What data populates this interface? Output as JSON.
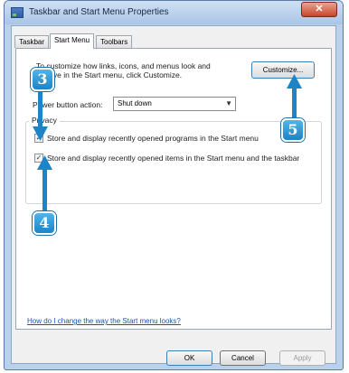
{
  "window": {
    "title": "Taskbar and Start Menu Properties",
    "close_glyph": "✕"
  },
  "tabs": [
    {
      "label": "Taskbar",
      "active": false
    },
    {
      "label": "Start Menu",
      "active": true
    },
    {
      "label": "Toolbars",
      "active": false
    }
  ],
  "start_menu": {
    "description": "To customize how links, icons, and menus look and behave in the Start menu, click Customize.",
    "customize_label": "Customize...",
    "power_button_label": "Power button action:",
    "power_button_value": "Shut down",
    "privacy_title": "Privacy",
    "privacy_options": [
      {
        "label": "Store and display recently opened programs in the Start menu",
        "checked": true
      },
      {
        "label": "Store and display recently opened items in the Start menu and the taskbar",
        "checked": true
      }
    ],
    "help_link": "How do I change the way the Start menu looks?"
  },
  "footer": {
    "ok_label": "OK",
    "cancel_label": "Cancel",
    "apply_label": "Apply"
  },
  "callouts": [
    "3",
    "4",
    "5"
  ],
  "colors": {
    "callout": "#1c84c7",
    "link": "#1e4fb3",
    "title_bar": "#b9d1ea"
  }
}
